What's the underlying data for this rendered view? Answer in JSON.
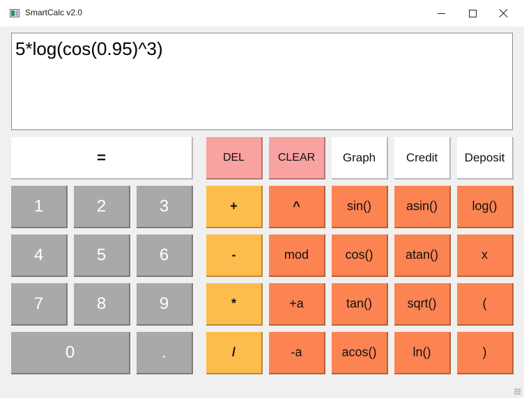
{
  "window": {
    "title": "SmartCalc v2.0"
  },
  "display": {
    "expression": "5*log(cos(0.95)^3)"
  },
  "buttons": {
    "equals": "=",
    "del": "DEL",
    "clear": "CLEAR",
    "graph": "Graph",
    "credit": "Credit",
    "deposit": "Deposit",
    "d1": "1",
    "d2": "2",
    "d3": "3",
    "d4": "4",
    "d5": "5",
    "d6": "6",
    "d7": "7",
    "d8": "8",
    "d9": "9",
    "d0": "0",
    "dot": ".",
    "plus": "+",
    "minus": "-",
    "mul": "*",
    "div": "/",
    "pow": "^",
    "mod": "mod",
    "unary_plus": "+a",
    "unary_minus": "-a",
    "sin": "sin()",
    "cos": "cos()",
    "tan": "tan()",
    "acos": "acos()",
    "asin": "asin()",
    "atan": "atan()",
    "sqrt": "sqrt()",
    "ln": "ln()",
    "log": "log()",
    "x": "x",
    "lparen": "(",
    "rparen": ")"
  },
  "colors": {
    "display_bg": "#ffffff",
    "pink": "#f8a2a2",
    "gray": "#a9a9a9",
    "yellow": "#fdbd4c",
    "orange": "#fb8452"
  }
}
